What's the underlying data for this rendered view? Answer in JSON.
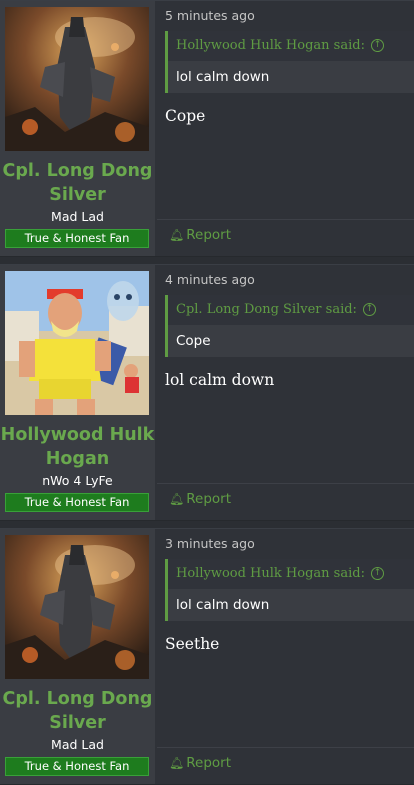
{
  "posts": [
    {
      "username": "Cpl. Long Dong Silver",
      "user_title": "Mad Lad",
      "badge": "True & Honest Fan",
      "avatar": "battle-ruins-avatar",
      "time": "5 minutes ago",
      "quote_author": "Hollywood Hulk Hogan said:",
      "quote_text": "lol calm down",
      "message": "Cope",
      "report_label": "Report"
    },
    {
      "username": "Hollywood Hulk Hogan",
      "user_title": "nWo 4 LyFe",
      "badge": "True & Honest Fan",
      "avatar": "wrestler-cartoon-avatar",
      "time": "4 minutes ago",
      "quote_author": "Cpl. Long Dong Silver said:",
      "quote_text": "Cope",
      "message": "lol calm down",
      "report_label": "Report"
    },
    {
      "username": "Cpl. Long Dong Silver",
      "user_title": "Mad Lad",
      "badge": "True & Honest Fan",
      "avatar": "battle-ruins-avatar",
      "time": "3 minutes ago",
      "quote_author": "Hollywood Hulk Hogan said:",
      "quote_text": "lol calm down",
      "message": "Seethe",
      "report_label": "Report"
    }
  ],
  "colors": {
    "accent": "#5f9c43",
    "badge_bg": "#1e7c1e",
    "background": "#2b2e33"
  }
}
